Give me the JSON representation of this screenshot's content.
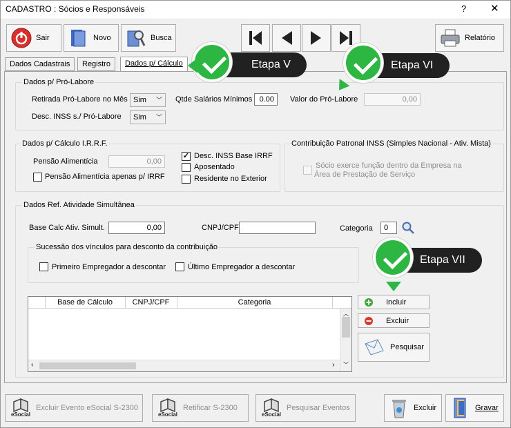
{
  "window": {
    "title": "CADASTRO : Sócios e Responsáveis",
    "help": "?",
    "close": "✕"
  },
  "toolbar": {
    "sair": "Sair",
    "novo": "Novo",
    "busca": "Busca",
    "relatorio": "Relatório"
  },
  "tabs": [
    {
      "label": "Dados Cadastrais"
    },
    {
      "label": "Registro"
    },
    {
      "label": "Dados p/ Cálculo"
    }
  ],
  "callouts": {
    "v": "Etapa V",
    "vi": "Etapa VI",
    "vii": "Etapa VII"
  },
  "pro_labore": {
    "group": "Dados p/ Pró-Labore",
    "retirada_label": "Retirada Pró-Labore no Mês",
    "retirada_value": "Sim",
    "qtde_label": "Qtde Salários Mínimos",
    "qtde_value": "0.00",
    "valor_label": "Valor do Pró-Labore",
    "valor_value": "0,00",
    "desc_inss_label": "Desc. INSS s./ Pró-Labore",
    "desc_inss_value": "Sim"
  },
  "irrf": {
    "group": "Dados p/ Cálculo I.R.R.F.",
    "pensao_label": "Pensão Alimentícia",
    "pensao_value": "0,00",
    "pensao_apenas": "Pensão Alimentícia apenas p/ IRRF",
    "desc_inss_base": "Desc. INSS Base IRRF",
    "aposentado": "Aposentado",
    "residente": "Residente no Exterior"
  },
  "patronal": {
    "group": "Contribuição Patronal INSS (Simples Nacional - Ativ. Mista)",
    "socio_line1": "Sócio exerce função dentro da Empresa na",
    "socio_line2": "Área de Prestação de Serviço"
  },
  "simultanea": {
    "group": "Dados Ref. Atividade Simultânea",
    "base_label": "Base Calc Ativ. Simult.",
    "base_value": "0,00",
    "cnpj_label": "CNPJ/CPF",
    "cnpj_value": "",
    "categoria_label": "Categoria",
    "categoria_value": "0",
    "sucessao_group": "Sucessão dos vínculos para desconto da contribuição",
    "primeiro": "Primeiro Empregador a descontar",
    "ultimo": "Último Empregador a descontar"
  },
  "grid": {
    "columns": [
      "Base de Cálculo",
      "CNPJ/CPF",
      "Categoria"
    ]
  },
  "actions": {
    "incluir": "Incluir",
    "excluir": "Excluir",
    "pesquisar": "Pesquisar"
  },
  "bottom": {
    "esocial": "eSocial",
    "excluir_evento": "Excluir Evento eSocial S-2300",
    "retificar": "Retificar S-2300",
    "pesquisar_eventos": "Pesquisar Eventos",
    "excluir": "Excluir",
    "gravar": "Gravar"
  },
  "colors": {
    "accent_green": "#2db742",
    "callout_bg": "#212121",
    "sair_red": "#d9302c"
  }
}
